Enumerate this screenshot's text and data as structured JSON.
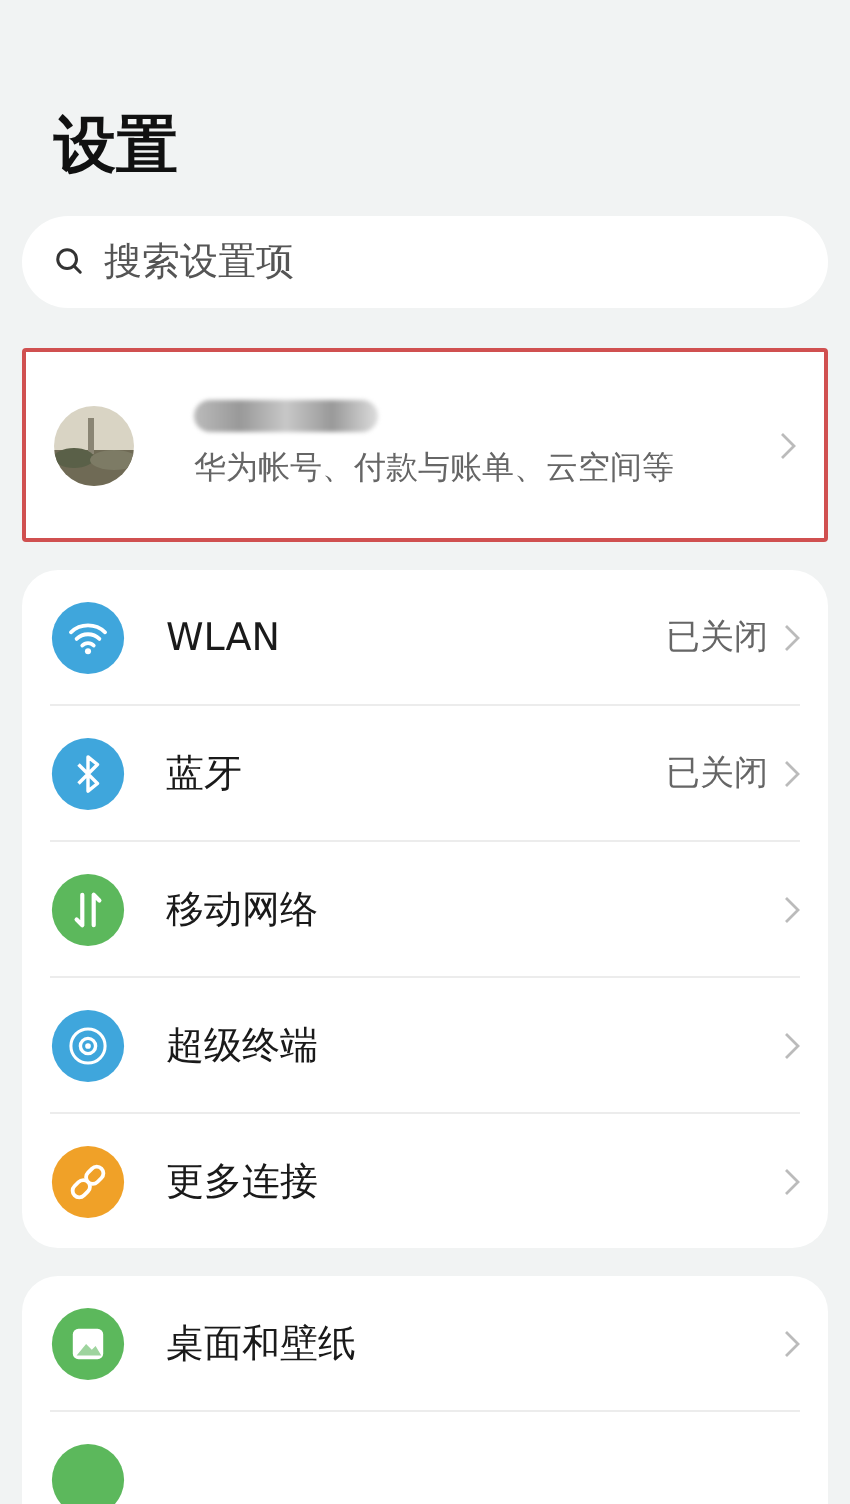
{
  "title": "设置",
  "search": {
    "placeholder": "搜索设置项"
  },
  "account": {
    "subtitle": "华为帐号、付款与账单、云空间等",
    "highlighted": true
  },
  "groups": [
    {
      "items": [
        {
          "kind": "wifi",
          "color": "#3fa6dc",
          "label": "WLAN",
          "value": "已关闭"
        },
        {
          "kind": "bluetooth",
          "color": "#3fa6dc",
          "label": "蓝牙",
          "value": "已关闭"
        },
        {
          "kind": "mobile",
          "color": "#5cb85c",
          "label": "移动网络"
        },
        {
          "kind": "devices",
          "color": "#3fa6dc",
          "label": "超级终端"
        },
        {
          "kind": "connections",
          "color": "#f0a128",
          "label": "更多连接"
        }
      ]
    },
    {
      "items": [
        {
          "kind": "wallpaper",
          "color": "#5cb85c",
          "label": "桌面和壁纸"
        },
        {
          "kind": "partial",
          "color": "#5cb85c"
        }
      ]
    }
  ]
}
